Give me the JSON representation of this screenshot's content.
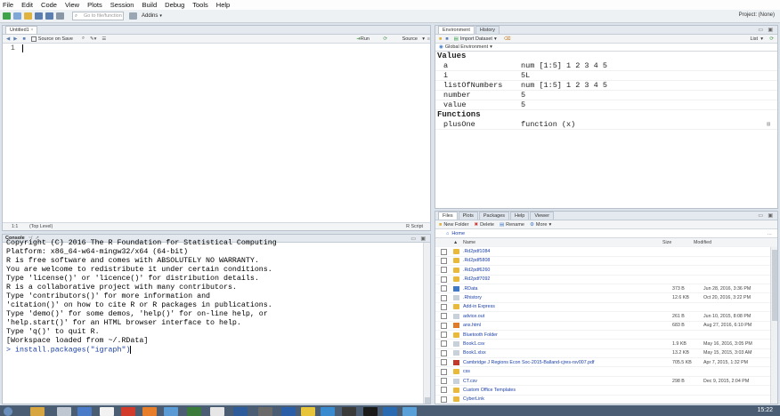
{
  "menu": [
    "File",
    "Edit",
    "Code",
    "View",
    "Plots",
    "Session",
    "Build",
    "Debug",
    "Tools",
    "Help"
  ],
  "toolbar": {
    "goto_placeholder": "Go to file/function",
    "addins": "Addins",
    "project": "Project: (None)"
  },
  "editor": {
    "tab": "Untitled1",
    "source_on_save": "Source on Save",
    "run": "Run",
    "source": "Source",
    "line_number": "1",
    "status_pos": "1:1",
    "status_scope": "(Top Level)",
    "status_type": "R Script"
  },
  "console": {
    "tab": "Console",
    "path": "~/",
    "lines": [
      "Copyright (C) 2016 The R Foundation for Statistical Computing",
      "Platform: x86_64-w64-mingw32/x64 (64-bit)",
      "",
      "R is free software and comes with ABSOLUTELY NO WARRANTY.",
      "You are welcome to redistribute it under certain conditions.",
      "Type 'license()' or 'licence()' for distribution details.",
      "",
      "R is a collaborative project with many contributors.",
      "Type 'contributors()' for more information and",
      "'citation()' on how to cite R or R packages in publications.",
      "",
      "Type 'demo()' for some demos, 'help()' for on-line help, or",
      "'help.start()' for an HTML browser interface to help.",
      "Type 'q()' to quit R.",
      "",
      "[Workspace loaded from ~/.RData]",
      ""
    ],
    "prompt": ">",
    "input": "install.packages(\"igraph\")"
  },
  "environment": {
    "tabs": [
      "Environment",
      "History"
    ],
    "import_label": "Import Dataset",
    "list_label": "List",
    "scope": "Global Environment",
    "sections": [
      {
        "title": "Values",
        "rows": [
          {
            "name": "a",
            "value": "num [1:5] 1 2 3 4 5"
          },
          {
            "name": "i",
            "value": "5L"
          },
          {
            "name": "listOfNumbers",
            "value": "num [1:5] 1 2 3 4 5"
          },
          {
            "name": "number",
            "value": "5"
          },
          {
            "name": "value",
            "value": "5"
          }
        ]
      },
      {
        "title": "Functions",
        "rows": [
          {
            "name": "plusOne",
            "value": "function (x)"
          }
        ]
      }
    ]
  },
  "files": {
    "tabs": [
      "Files",
      "Plots",
      "Packages",
      "Help",
      "Viewer"
    ],
    "new_folder": "New Folder",
    "delete": "Delete",
    "rename": "Rename",
    "more": "More",
    "breadcrumb": "Home",
    "headers": {
      "name": "Name",
      "size": "Size",
      "modified": "Modified"
    },
    "rows": [
      {
        "name": ".Rd2pdf1084",
        "size": "",
        "modified": "",
        "kind": "folder"
      },
      {
        "name": ".Rd2pdf5808",
        "size": "",
        "modified": "",
        "kind": "folder"
      },
      {
        "name": ".Rd2pdf6260",
        "size": "",
        "modified": "",
        "kind": "folder"
      },
      {
        "name": ".Rd2pdf7092",
        "size": "",
        "modified": "",
        "kind": "folder"
      },
      {
        "name": ".RData",
        "size": "373 B",
        "modified": "Jun 28, 2016, 3:36 PM",
        "kind": "rdata"
      },
      {
        "name": ".Rhistory",
        "size": "12.6 KB",
        "modified": "Oct 20, 2016, 3:22 PM",
        "kind": "file"
      },
      {
        "name": "Add-in Express",
        "size": "",
        "modified": "",
        "kind": "folder"
      },
      {
        "name": "advice.out",
        "size": "261 B",
        "modified": "Jun 10, 2015, 8:08 PM",
        "kind": "file"
      },
      {
        "name": "ans.html",
        "size": "683 B",
        "modified": "Aug 27, 2016, 6:10 PM",
        "kind": "html"
      },
      {
        "name": "Bluetooth Folder",
        "size": "",
        "modified": "",
        "kind": "folder"
      },
      {
        "name": "Book1.csv",
        "size": "1.9 KB",
        "modified": "May 16, 2016, 3:05 PM",
        "kind": "file"
      },
      {
        "name": "Book1.xlsx",
        "size": "13.2 KB",
        "modified": "May 15, 2015, 3:03 AM",
        "kind": "file"
      },
      {
        "name": "Cambridge J Regions Econ Soc-2015-Balland-cjres-rsv007.pdf",
        "size": "705.5 KB",
        "modified": "Apr 7, 2015, 1:32 PM",
        "kind": "pdf"
      },
      {
        "name": "css",
        "size": "",
        "modified": "",
        "kind": "folder"
      },
      {
        "name": "CT.csv",
        "size": "298 B",
        "modified": "Dec 9, 2015, 2:04 PM",
        "kind": "file"
      },
      {
        "name": "Custom Office Templates",
        "size": "",
        "modified": "",
        "kind": "folder"
      },
      {
        "name": "CyberLink",
        "size": "",
        "modified": "",
        "kind": "folder"
      }
    ]
  },
  "taskbar": {
    "clock": "15:22"
  },
  "colors": {
    "folder": "#e8b93a",
    "link": "#1a3fa6",
    "accent": "#3f78c7"
  }
}
